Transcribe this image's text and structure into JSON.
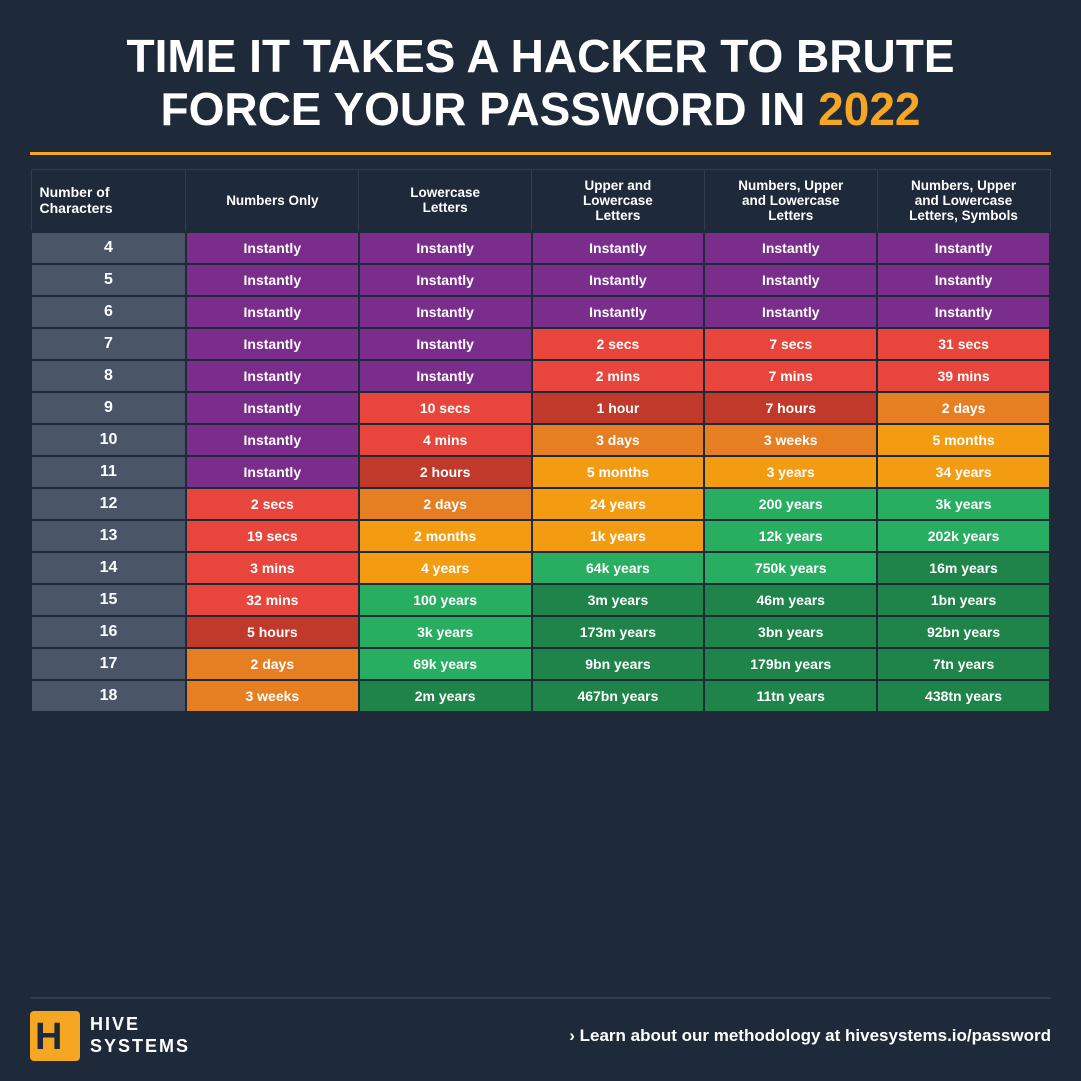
{
  "title": {
    "line1": "TIME IT TAKES A HACKER TO BRUTE",
    "line2_prefix": "FORCE YOUR PASSWORD IN ",
    "year": "2022"
  },
  "columns": [
    "Number of\nCharacters",
    "Numbers Only",
    "Lowercase\nLetters",
    "Upper and\nLowercase\nLetters",
    "Numbers, Upper\nand Lowercase\nLetters",
    "Numbers, Upper\nand Lowercase\nLetters, Symbols"
  ],
  "rows": [
    {
      "chars": "4",
      "c1": "Instantly",
      "c2": "Instantly",
      "c3": "Instantly",
      "c4": "Instantly",
      "c5": "Instantly"
    },
    {
      "chars": "5",
      "c1": "Instantly",
      "c2": "Instantly",
      "c3": "Instantly",
      "c4": "Instantly",
      "c5": "Instantly"
    },
    {
      "chars": "6",
      "c1": "Instantly",
      "c2": "Instantly",
      "c3": "Instantly",
      "c4": "Instantly",
      "c5": "Instantly"
    },
    {
      "chars": "7",
      "c1": "Instantly",
      "c2": "Instantly",
      "c3": "2 secs",
      "c4": "7 secs",
      "c5": "31 secs"
    },
    {
      "chars": "8",
      "c1": "Instantly",
      "c2": "Instantly",
      "c3": "2 mins",
      "c4": "7 mins",
      "c5": "39 mins"
    },
    {
      "chars": "9",
      "c1": "Instantly",
      "c2": "10 secs",
      "c3": "1 hour",
      "c4": "7 hours",
      "c5": "2 days"
    },
    {
      "chars": "10",
      "c1": "Instantly",
      "c2": "4 mins",
      "c3": "3 days",
      "c4": "3 weeks",
      "c5": "5 months"
    },
    {
      "chars": "11",
      "c1": "Instantly",
      "c2": "2 hours",
      "c3": "5 months",
      "c4": "3 years",
      "c5": "34 years"
    },
    {
      "chars": "12",
      "c1": "2 secs",
      "c2": "2 days",
      "c3": "24 years",
      "c4": "200 years",
      "c5": "3k years"
    },
    {
      "chars": "13",
      "c1": "19 secs",
      "c2": "2 months",
      "c3": "1k years",
      "c4": "12k years",
      "c5": "202k years"
    },
    {
      "chars": "14",
      "c1": "3 mins",
      "c2": "4 years",
      "c3": "64k years",
      "c4": "750k years",
      "c5": "16m years"
    },
    {
      "chars": "15",
      "c1": "32 mins",
      "c2": "100 years",
      "c3": "3m years",
      "c4": "46m years",
      "c5": "1bn years"
    },
    {
      "chars": "16",
      "c1": "5 hours",
      "c2": "3k years",
      "c3": "173m years",
      "c4": "3bn years",
      "c5": "92bn years"
    },
    {
      "chars": "17",
      "c1": "2 days",
      "c2": "69k years",
      "c3": "9bn years",
      "c4": "179bn years",
      "c5": "7tn years"
    },
    {
      "chars": "18",
      "c1": "3 weeks",
      "c2": "2m years",
      "c3": "467bn years",
      "c4": "11tn years",
      "c5": "438tn years"
    }
  ],
  "footer": {
    "logo_line1": "HIVE",
    "logo_line2": "SYSTEMS",
    "link_text": "› Learn about our methodology at ",
    "link_url": "hivesystems.io/password"
  },
  "colors": {
    "instantly": "#7b2d8b",
    "seconds_mins": "#e8453c",
    "hours_days": "#c0392b",
    "weeks_months": "#e67e22",
    "years_low": "#f39c12",
    "years_high": "#27ae60",
    "years_max": "#1e8449",
    "char_col": "#4a5568"
  }
}
